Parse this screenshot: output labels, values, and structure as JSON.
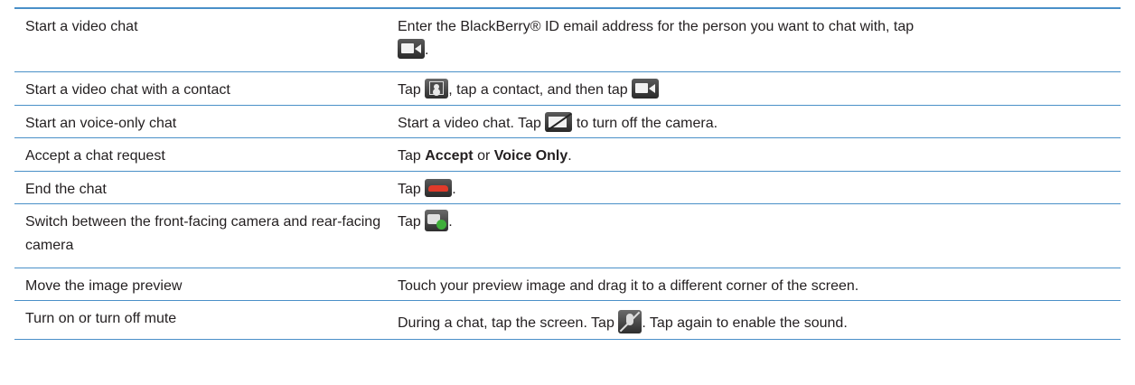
{
  "rows": [
    {
      "action": "Start a video chat",
      "desc_1": "Enter the BlackBerry® ID email address for the person you want to chat with, tap",
      "desc_2": ".",
      "icon": "video-camera-icon"
    },
    {
      "action": "Start a video chat with a contact",
      "desc_1": "Tap",
      "desc_2": ", tap a contact, and then tap",
      "icons": [
        "contacts-icon",
        "video-camera-icon"
      ]
    },
    {
      "action": "Start an voice-only chat",
      "desc_1": "Start a video chat. Tap",
      "desc_2": "to turn off the camera.",
      "icon": "camera-off-icon"
    },
    {
      "action": "Accept a chat request",
      "desc_1": "Tap",
      "bold_1": "Accept",
      "desc_2": "or",
      "bold_2": "Voice Only",
      "desc_3": "."
    },
    {
      "action": "End the chat",
      "desc_1": "Tap",
      "desc_2": ".",
      "icon": "end-call-icon"
    },
    {
      "action": "Switch between the front-facing camera and rear-facing camera",
      "desc_1": "Tap",
      "desc_2": ".",
      "icon": "switch-camera-icon"
    },
    {
      "action": "Move the image preview",
      "desc_1": "Touch your preview image and drag it to a different corner of the screen."
    },
    {
      "action": "Turn on or turn off mute",
      "desc_1": "During a chat, tap the screen. Tap",
      "desc_2": ". Tap again to enable the sound.",
      "icon": "mute-microphone-icon"
    }
  ],
  "colors": {
    "rule": "#4a90c8",
    "text": "#231f20"
  }
}
